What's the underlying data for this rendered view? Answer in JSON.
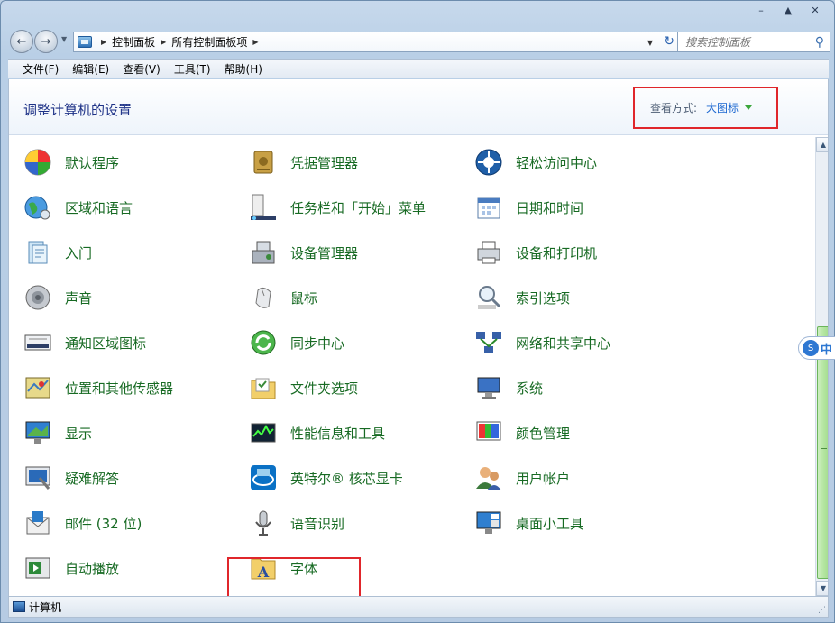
{
  "window": {
    "controls": {
      "minimize": "–",
      "maximize": "▲",
      "close": "✕"
    }
  },
  "address_bar": {
    "breadcrumbs": [
      "控制面板",
      "所有控制面板项"
    ]
  },
  "search": {
    "placeholder": "搜索控制面板"
  },
  "menu": [
    "文件(F)",
    "编辑(E)",
    "查看(V)",
    "工具(T)",
    "帮助(H)"
  ],
  "header": {
    "title": "调整计算机的设置",
    "view_label": "查看方式:",
    "view_value": "大图标"
  },
  "items": [
    {
      "label": "默认程序",
      "icon": "default-programs-icon"
    },
    {
      "label": "凭据管理器",
      "icon": "credential-manager-icon"
    },
    {
      "label": "轻松访问中心",
      "icon": "ease-of-access-icon"
    },
    {
      "label": "区域和语言",
      "icon": "region-language-icon"
    },
    {
      "label": "任务栏和「开始」菜单",
      "icon": "taskbar-start-menu-icon"
    },
    {
      "label": "日期和时间",
      "icon": "date-time-icon"
    },
    {
      "label": "入门",
      "icon": "getting-started-icon"
    },
    {
      "label": "设备管理器",
      "icon": "device-manager-icon"
    },
    {
      "label": "设备和打印机",
      "icon": "devices-printers-icon"
    },
    {
      "label": "声音",
      "icon": "sound-icon"
    },
    {
      "label": "鼠标",
      "icon": "mouse-icon"
    },
    {
      "label": "索引选项",
      "icon": "indexing-options-icon"
    },
    {
      "label": "通知区域图标",
      "icon": "notification-area-icon"
    },
    {
      "label": "同步中心",
      "icon": "sync-center-icon"
    },
    {
      "label": "网络和共享中心",
      "icon": "network-sharing-icon"
    },
    {
      "label": "位置和其他传感器",
      "icon": "location-sensors-icon"
    },
    {
      "label": "文件夹选项",
      "icon": "folder-options-icon"
    },
    {
      "label": "系统",
      "icon": "system-icon"
    },
    {
      "label": "显示",
      "icon": "display-icon"
    },
    {
      "label": "性能信息和工具",
      "icon": "performance-tools-icon"
    },
    {
      "label": "颜色管理",
      "icon": "color-management-icon"
    },
    {
      "label": "疑难解答",
      "icon": "troubleshooting-icon"
    },
    {
      "label": "英特尔® 核芯显卡",
      "icon": "intel-graphics-icon"
    },
    {
      "label": "用户帐户",
      "icon": "user-accounts-icon"
    },
    {
      "label": "邮件 (32 位)",
      "icon": "mail-icon"
    },
    {
      "label": "语音识别",
      "icon": "speech-recognition-icon"
    },
    {
      "label": "桌面小工具",
      "icon": "desktop-gadgets-icon"
    },
    {
      "label": "自动播放",
      "icon": "autoplay-icon"
    },
    {
      "label": "字体",
      "icon": "fonts-icon"
    }
  ],
  "status_bar": {
    "text": "计算机"
  },
  "ime": {
    "text": "中"
  }
}
